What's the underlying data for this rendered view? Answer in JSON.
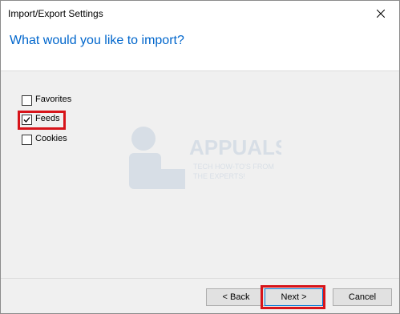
{
  "window": {
    "title": "Import/Export Settings",
    "close_icon": "close-icon"
  },
  "header": {
    "question": "What would you like to import?"
  },
  "options": [
    {
      "label": "Favorites",
      "checked": false
    },
    {
      "label": "Feeds",
      "checked": true
    },
    {
      "label": "Cookies",
      "checked": false
    }
  ],
  "watermark": {
    "brand": "APPUALS",
    "tagline_1": "TECH HOW-TO'S FROM",
    "tagline_2": "THE EXPERTS!"
  },
  "buttons": {
    "back": "< Back",
    "next": "Next >",
    "cancel": "Cancel"
  },
  "colors": {
    "header_text": "#0066cc",
    "highlight": "#d7141a",
    "primary_border": "#0078d7"
  }
}
